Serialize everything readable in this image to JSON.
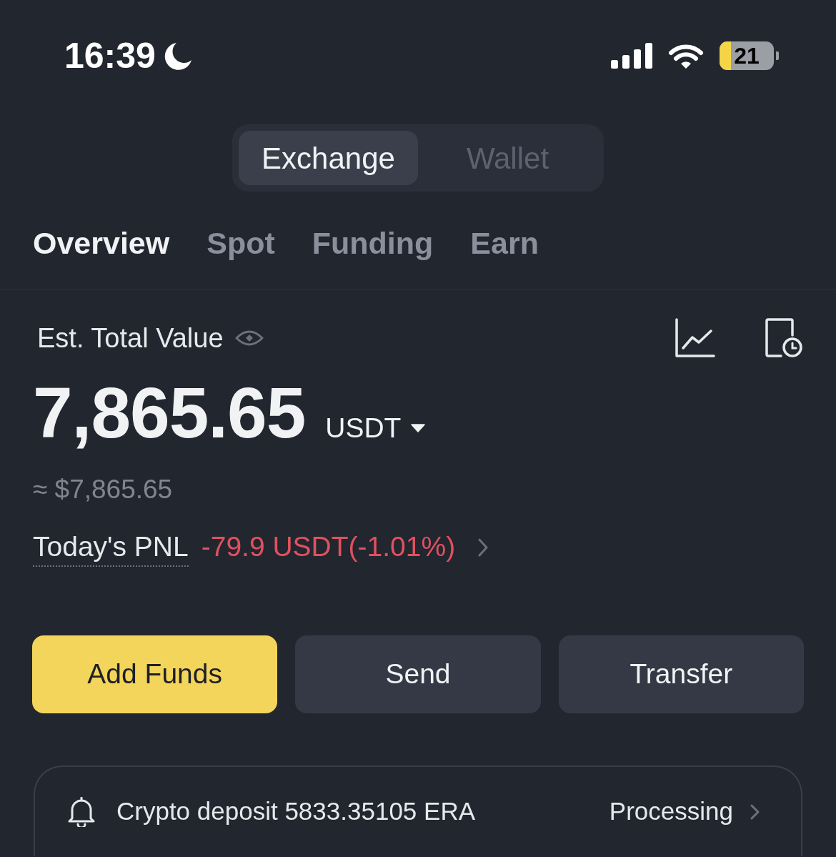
{
  "status_bar": {
    "time": "16:39",
    "battery": "21"
  },
  "mode_switch": [
    {
      "label": "Exchange",
      "selected": true
    },
    {
      "label": "Wallet",
      "selected": false
    }
  ],
  "tabs": [
    {
      "label": "Overview",
      "selected": true
    },
    {
      "label": "Spot",
      "selected": false
    },
    {
      "label": "Funding",
      "selected": false
    },
    {
      "label": "Earn",
      "selected": false
    }
  ],
  "balance": {
    "label": "Est. Total Value",
    "value": "7,865.65",
    "currency": "USDT",
    "fiat": "≈ $7,865.65",
    "pnl_label": "Today's PNL",
    "pnl_value": "-79.9 USDT(-1.01%)",
    "pnl_negative": true
  },
  "actions": [
    {
      "label": "Add Funds",
      "kind": "primary"
    },
    {
      "label": "Send",
      "kind": "secondary"
    },
    {
      "label": "Transfer",
      "kind": "secondary"
    }
  ],
  "notice": {
    "text": "Crypto deposit 5833.35105 ERA",
    "status": "Processing"
  }
}
